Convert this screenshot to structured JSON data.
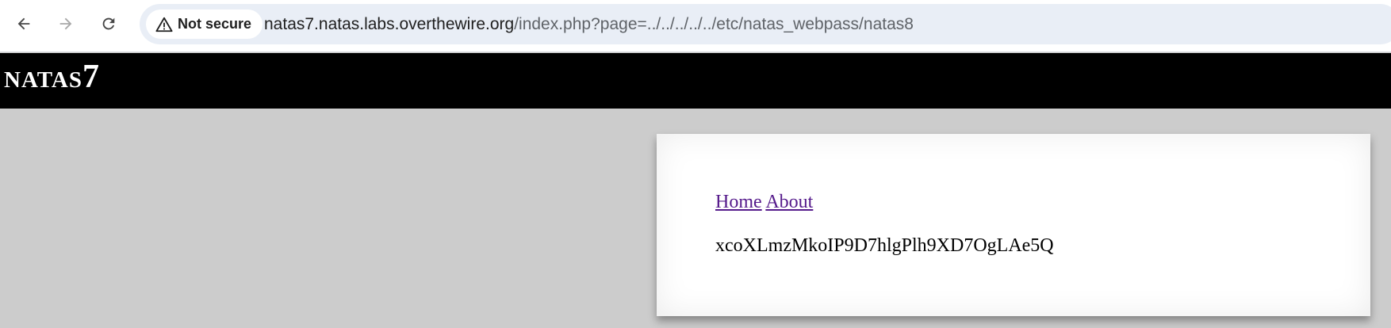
{
  "browser": {
    "security_label": "Not secure",
    "url_host": "natas7.natas.labs.overthewire.org",
    "url_path": "/index.php?page=../../../../../etc/natas_webpass/natas8",
    "icons": {
      "back": "arrow-left-icon",
      "forward": "arrow-right-icon",
      "reload": "reload-icon",
      "security": "warning-triangle-icon"
    }
  },
  "page": {
    "title": "natas7",
    "links": {
      "home": "Home",
      "about": "About"
    },
    "content_text": "xcoXLmzMkoIP9D7hlgPlh9XD7OgLAe5Q",
    "link_color": "#551a8b",
    "header_color": "#000000",
    "background_color": "#cccccc"
  }
}
